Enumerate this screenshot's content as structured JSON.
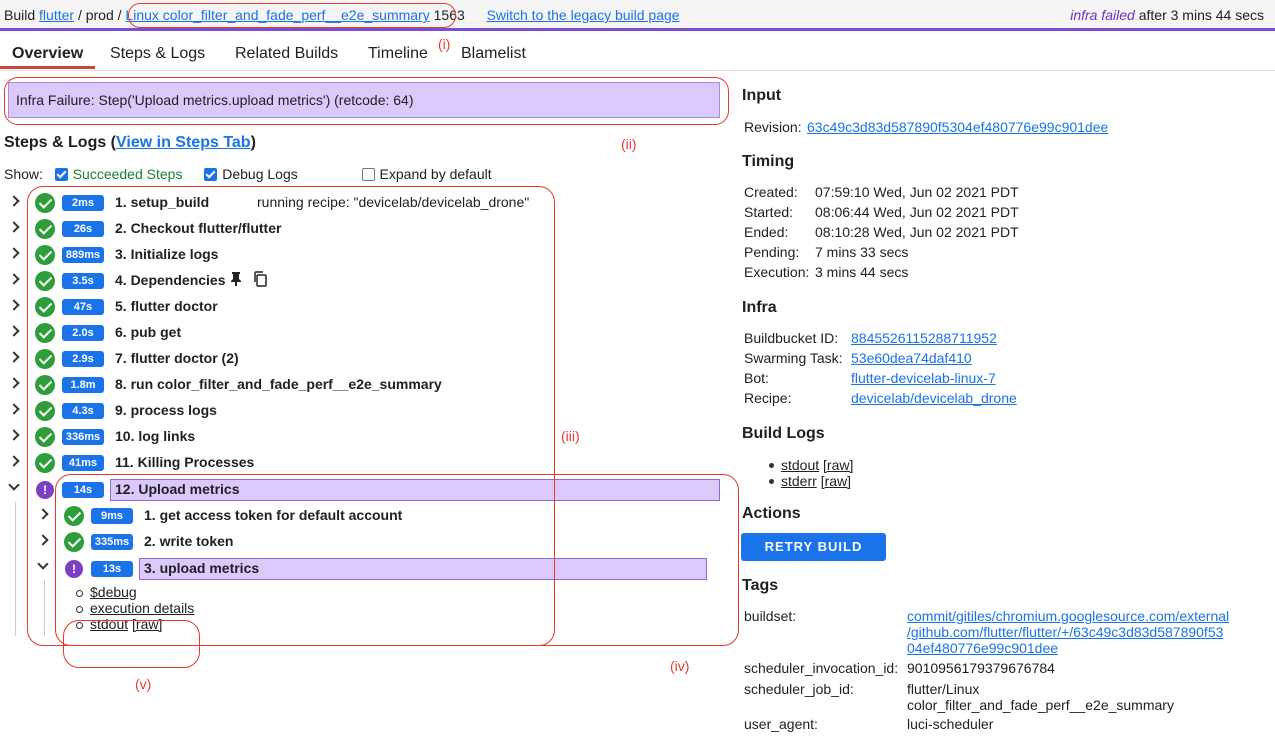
{
  "topbar": {
    "build": "Build",
    "project": "flutter",
    "slash1": "/",
    "bucket": "prod",
    "slash2": "/",
    "builder": "Linux color_filter_and_fade_perf__e2e_summary",
    "number": "1563",
    "legacy_link": "Switch to the legacy build page",
    "status_word": "infra failed",
    "status_rest": "after 3 mins 44 secs"
  },
  "tabs": [
    "Overview",
    "Steps & Logs",
    "Related Builds",
    "Timeline",
    "Blamelist"
  ],
  "banner": "Infra Failure: Step('Upload metrics.upload metrics') (retcode: 64)",
  "steps_header": {
    "title": "Steps & Logs (",
    "link": "View in Steps Tab",
    "close": ")",
    "show": "Show:",
    "succeeded": "Succeeded Steps",
    "debug": "Debug Logs",
    "expand": "Expand by default"
  },
  "steps": [
    {
      "dur": "2ms",
      "label": "1. setup_build",
      "summary": "running recipe: \"devicelab/devicelab_drone\""
    },
    {
      "dur": "26s",
      "label": "2. Checkout flutter/flutter"
    },
    {
      "dur": "889ms",
      "label": "3. Initialize logs"
    },
    {
      "dur": "3.5s",
      "label": "4. Dependencies"
    },
    {
      "dur": "47s",
      "label": "5. flutter doctor"
    },
    {
      "dur": "2.0s",
      "label": "6. pub get"
    },
    {
      "dur": "2.9s",
      "label": "7. flutter doctor (2)"
    },
    {
      "dur": "1.8m",
      "label": "8. run color_filter_and_fade_perf__e2e_summary"
    },
    {
      "dur": "4.3s",
      "label": "9. process logs"
    },
    {
      "dur": "336ms",
      "label": "10. log links"
    },
    {
      "dur": "41ms",
      "label": "11. Killing Processes"
    },
    {
      "dur": "14s",
      "label": "12. Upload metrics"
    }
  ],
  "substeps": [
    {
      "dur": "9ms",
      "label": "1. get access token for default account"
    },
    {
      "dur": "335ms",
      "label": "2. write token"
    },
    {
      "dur": "13s",
      "label": "3. upload metrics"
    }
  ],
  "sublinks": {
    "debug": "$debug",
    "exec": "execution details",
    "stdout": "stdout",
    "raw": "[raw]"
  },
  "annotations": {
    "i": "(i)",
    "ii": "(ii)",
    "iii": "(iii)",
    "iv": "(iv)",
    "v": "(v)"
  },
  "input": {
    "title": "Input",
    "rev_label": "Revision:",
    "rev": "63c49c3d83d587890f5304ef480776e99c901dee"
  },
  "timing": {
    "title": "Timing",
    "rows": [
      {
        "k": "Created:",
        "v": "07:59:10 Wed, Jun 02 2021 PDT"
      },
      {
        "k": "Started:",
        "v": "08:06:44 Wed, Jun 02 2021 PDT"
      },
      {
        "k": "Ended:",
        "v": "08:10:28 Wed, Jun 02 2021 PDT"
      },
      {
        "k": "Pending:",
        "v": "7 mins 33 secs"
      },
      {
        "k": "Execution:",
        "v": "3 mins 44 secs"
      }
    ]
  },
  "infra": {
    "title": "Infra",
    "rows": [
      {
        "k": "Buildbucket ID:",
        "v": "8845526115288711952"
      },
      {
        "k": "Swarming Task:",
        "v": "53e60dea74daf410"
      },
      {
        "k": "Bot:",
        "v": "flutter-devicelab-linux-7"
      },
      {
        "k": "Recipe:",
        "v": "devicelab/devicelab_drone"
      }
    ]
  },
  "build_logs": {
    "title": "Build Logs",
    "stdout": "stdout",
    "stderr": "stderr",
    "raw": "[raw]"
  },
  "actions": {
    "title": "Actions",
    "retry": "RETRY BUILD"
  },
  "tags": {
    "title": "Tags",
    "buildset_k": "buildset:",
    "buildset_l1": "commit/gitiles/chromium.googlesource.com/external",
    "buildset_l2": "/github.com/flutter/flutter/+/63c49c3d83d587890f53",
    "buildset_l3": "04ef480776e99c901dee",
    "inv_k": "scheduler_invocation_id:",
    "inv_v": "9010956179379676784",
    "job_k": "scheduler_job_id:",
    "job_l1": "flutter/Linux",
    "job_l2": "color_filter_and_fade_perf__e2e_summary",
    "ua_k": "user_agent:",
    "ua_v": "luci-scheduler"
  }
}
